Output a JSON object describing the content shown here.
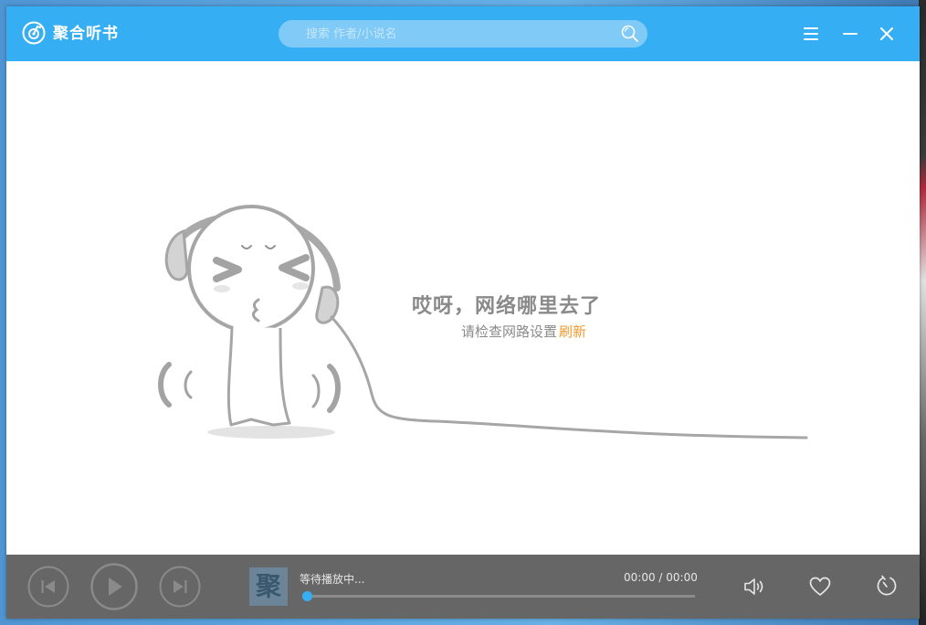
{
  "app": {
    "title": "聚合听书"
  },
  "search": {
    "placeholder": "搜索 作者/小说名"
  },
  "error": {
    "title": "哎呀，网络哪里去了",
    "subtitle": "请检查网路设置",
    "refresh_label": "刷新"
  },
  "player": {
    "cover_text": "聚",
    "status": "等待播放中...",
    "time": "00:00 / 00:00",
    "progress": 0
  },
  "colors": {
    "accent": "#36aef4",
    "refresh": "#f29a2c",
    "player_bg": "#666666"
  },
  "icons": {
    "logo": "disc-icon",
    "search": "search-icon",
    "menu": "menu-icon",
    "minimize": "minimize-icon",
    "close": "close-icon",
    "prev": "skip-previous-icon",
    "play": "play-icon",
    "next": "skip-next-icon",
    "volume": "volume-icon",
    "favorite": "heart-icon",
    "timer": "timer-icon"
  }
}
